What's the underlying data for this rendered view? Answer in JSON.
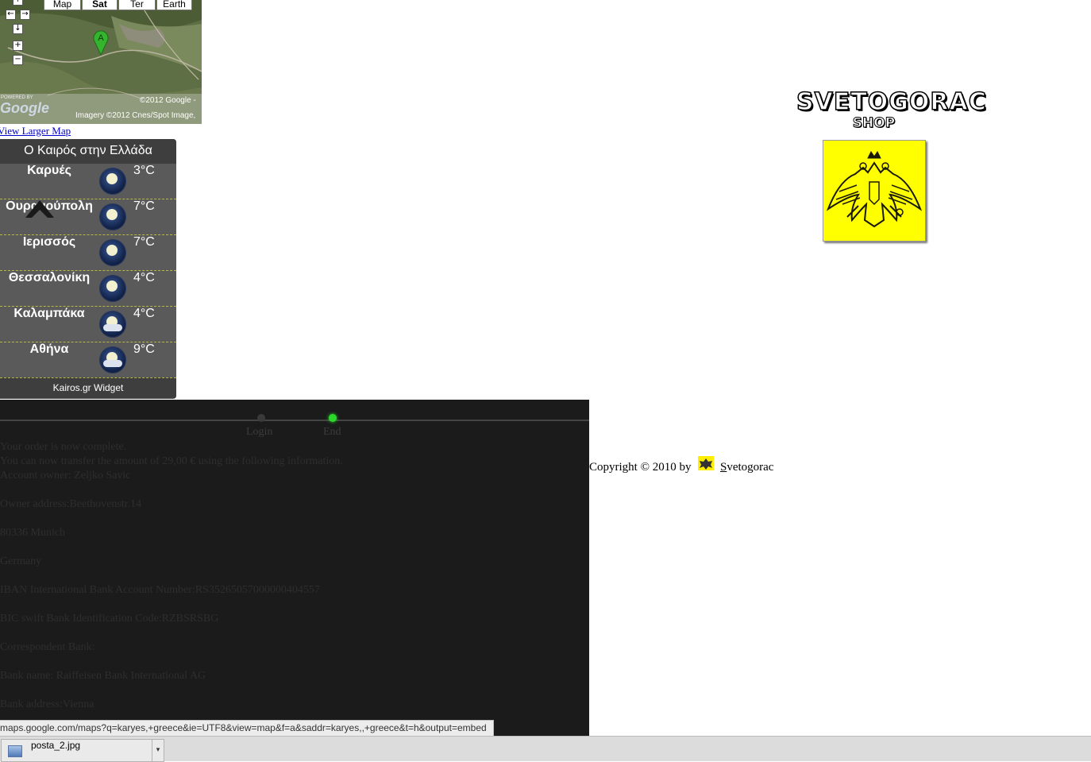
{
  "map": {
    "types": [
      "Map",
      "Sat",
      "Ter",
      "Earth"
    ],
    "selected_type": "Sat",
    "marker_label": "A",
    "powered_by": "POWERED BY",
    "logo": "Google",
    "copyright": "©2012 Google -",
    "imagery": "Imagery ©2012 Cnes/Spot Image,",
    "larger_map_link": "View Larger Map"
  },
  "weather": {
    "title": "Ο Καιρός στην Ελλάδα",
    "cities": [
      {
        "name": "Καρυές",
        "temp": "3°C",
        "icon": "night-clear-icon"
      },
      {
        "name": "Ουρανούπολη",
        "temp": "7°C",
        "icon": "night-clear-icon"
      },
      {
        "name": "Ιερισσός",
        "temp": "7°C",
        "icon": "night-clear-icon"
      },
      {
        "name": "Θεσσαλονίκη",
        "temp": "4°C",
        "icon": "night-clear-icon"
      },
      {
        "name": "Καλαμπάκα",
        "temp": "4°C",
        "icon": "night-cloudy-icon"
      },
      {
        "name": "Αθήνα",
        "temp": "9°C",
        "icon": "night-cloudy-icon"
      }
    ],
    "footer": "Kairos.gr Widget"
  },
  "shop": {
    "name": "SVETOGORAC",
    "sub": "SHOP",
    "emblem_color": "#ffff00"
  },
  "order": {
    "steps": [
      {
        "label": "Login",
        "active": false
      },
      {
        "label": "End",
        "active": true
      }
    ],
    "lines": [
      "Your order is now complete.",
      "You can now transfer the amount of 29,00 € using the following information.",
      "Account owner: Zeljko Savic",
      "Owner address:Beethovenstr.14",
      "80336 Munich",
      "Germany",
      "IBAN International Bank Account Number:RS35265057000000404557",
      "BIC swift Bank Identification Code:RZBSRSBG",
      "Correspondent Bank:",
      "Bank name: Raiffeisen Bank International AG",
      "Bank address:Vienna"
    ]
  },
  "footer": {
    "copyright": "Copyright © 2010 by",
    "link_first": "S",
    "link_rest": "vetogorac"
  },
  "status_url": "maps.google.com/maps?q=karyes,+greece&ie=UTF8&view=map&f=a&saddr=karyes,,+greece&t=h&output=embed",
  "download": {
    "file": "posta_2.jpg"
  }
}
